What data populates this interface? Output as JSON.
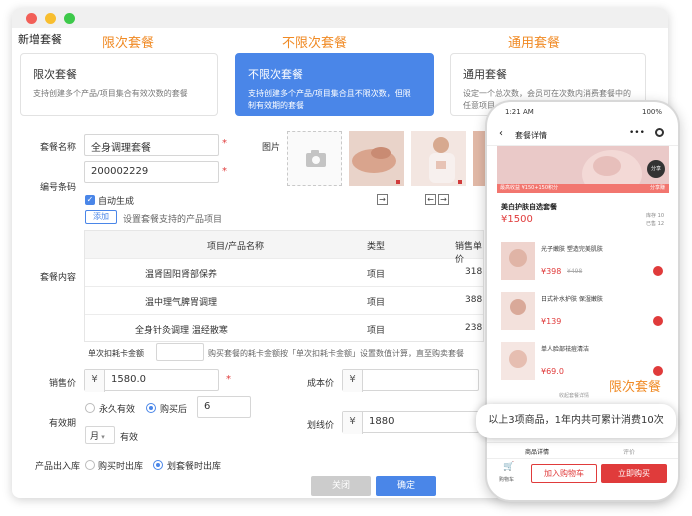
{
  "window": {
    "title": "新增套餐"
  },
  "category_labels": [
    "限次套餐",
    "不限次套餐",
    "通用套餐"
  ],
  "cards": [
    {
      "title": "限次套餐",
      "desc": "支持创建多个产品/项目集合有效次数的套餐"
    },
    {
      "title": "不限次套餐",
      "desc_lines": [
        "支持创建多个产品/项目集合且不限次数，但限",
        "制有效期的套餐"
      ]
    },
    {
      "title": "通用套餐",
      "desc_lines": [
        "设定一个总次数，会员可在次数内消费套餐中的",
        "任意项目"
      ]
    }
  ],
  "form": {
    "name_label": "套餐名称",
    "name_value": "全身调理套餐",
    "code_label": "编号条码",
    "code_value": "200002229",
    "auto_gen_label": "自动生成",
    "image_label": "图片",
    "add_button": "添加",
    "add_hint": "设置套餐支持的产品项目",
    "content_label": "套餐内容",
    "table": {
      "headers": [
        "项目/产品名称",
        "类型",
        "销售单价"
      ],
      "rows": [
        {
          "name": "温肾固阳肾部保养",
          "type": "项目",
          "price": "318"
        },
        {
          "name": "温中理气脾胃调理",
          "type": "项目",
          "price": "388"
        },
        {
          "name": "全身针灸调理 温经散寒",
          "type": "项目",
          "price": "238"
        }
      ]
    },
    "single_deduct_label": "单次扣耗卡金额",
    "single_deduct_hint": "购买套餐的耗卡金额按「单次扣耗卡金额」设置数值计算，直至购卖套餐",
    "sale_price_label": "销售价",
    "currency_symbol": "¥",
    "sale_price_value": "1580.0",
    "cost_price_label": "成本价",
    "validity_label": "有效期",
    "validity_forever": "永久有效",
    "validity_after": "购买后",
    "validity_number": "6",
    "validity_unit": "月",
    "validity_suffix": "有效",
    "strike_price_label": "划线价",
    "strike_price_value": "1880",
    "stock_label": "产品出入库",
    "stock_on_buy": "购买时出库",
    "stock_on_deduct": "划套餐时出库",
    "close_button": "关闭",
    "confirm_button": "确定"
  },
  "phone": {
    "time": "1:21 AM",
    "battery": "100%",
    "nav_title": "套餐详情",
    "share_label": "分享",
    "strip_text": "最高收益 ¥150+150积分",
    "share_badge": "分享赚",
    "package_title": "美白护肤自选套餐",
    "package_price": "¥1500",
    "stock_left": "库存 10",
    "sold_count": "已售 12",
    "items": [
      {
        "name": "光子嫩肤 塑造完美肌肤",
        "price": "¥398",
        "old": "¥498"
      },
      {
        "name": "日式补水护肤 保湿嫩肤",
        "price": "¥139",
        "old": ""
      },
      {
        "name": "单人脸部祛痘清洁",
        "price": "¥69.0",
        "old": ""
      }
    ],
    "collapse_text": "收起套餐详情",
    "promo_label": "限次套餐",
    "tabs": [
      "商品详情",
      "评价"
    ],
    "cart_label": "购物车",
    "add_cart": "加入购物车",
    "buy_now": "立即购买"
  },
  "tooltip": {
    "text": "以上3项商品，1年内共可累计消费10次"
  },
  "colors": {
    "accent": "#4a86e8",
    "orange": "#f08a24",
    "red": "#e03b3b"
  }
}
